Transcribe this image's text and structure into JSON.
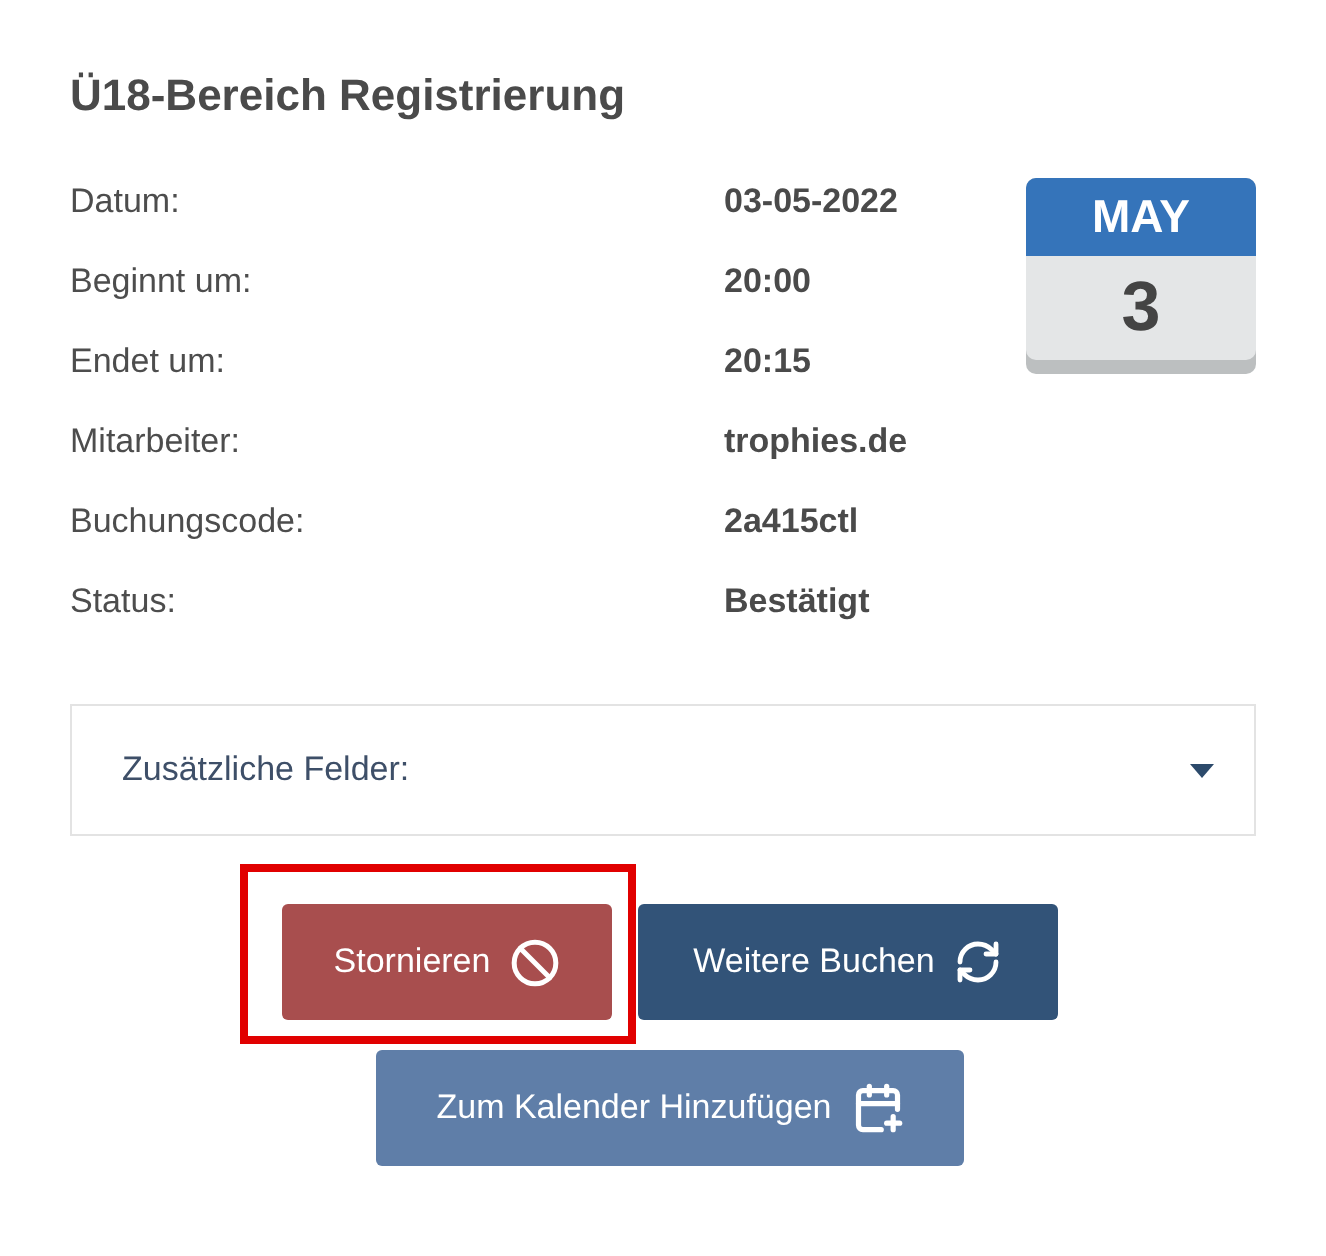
{
  "title": "Ü18-Bereich Registrierung",
  "details": [
    {
      "label": "Datum:",
      "value": "03-05-2022"
    },
    {
      "label": "Beginnt um:",
      "value": "20:00"
    },
    {
      "label": "Endet um:",
      "value": "20:15"
    },
    {
      "label": "Mitarbeiter:",
      "value": "trophies.de"
    },
    {
      "label": "Buchungscode:",
      "value": "2a415ctl"
    },
    {
      "label": "Status:",
      "value": "Bestätigt"
    }
  ],
  "calendar_badge": {
    "month": "MAY",
    "day": "3"
  },
  "additional_fields": {
    "label": "Zusätzliche Felder:",
    "expanded": false
  },
  "buttons": [
    {
      "label": "Stornieren",
      "kind": "cancel",
      "highlighted": true
    },
    {
      "label": "Weitere Buchen",
      "kind": "rebook",
      "highlighted": false
    },
    {
      "label": "Zum Kalender Hinzufügen",
      "kind": "add_to_calendar",
      "highlighted": false
    }
  ]
}
